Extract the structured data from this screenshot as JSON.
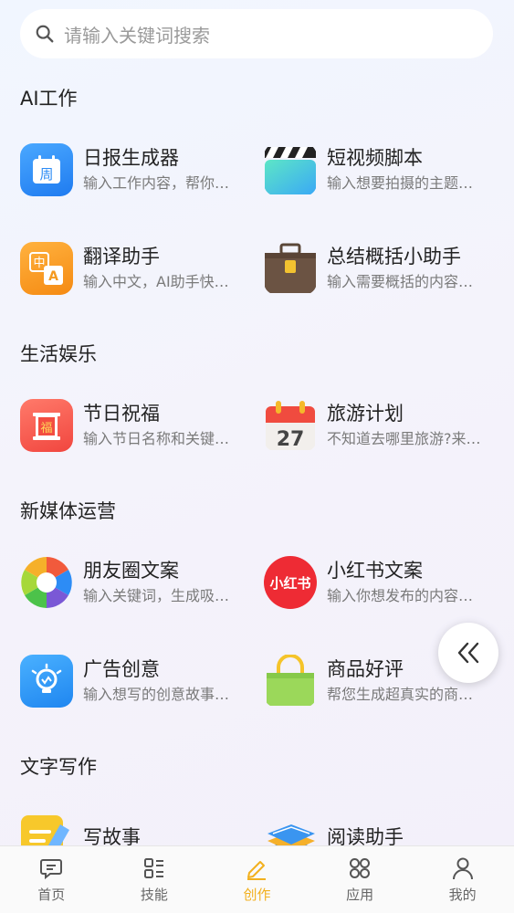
{
  "search": {
    "placeholder": "请输入关键词搜索"
  },
  "sections": [
    {
      "title": "AI工作",
      "items": [
        {
          "title": "日报生成器",
          "desc": "输入工作内容，帮你…",
          "icon": "calendar-week-icon"
        },
        {
          "title": "短视频脚本",
          "desc": "输入想要拍摄的主题…",
          "icon": "clapperboard-icon"
        },
        {
          "title": "翻译助手",
          "desc": "输入中文，AI助手快…",
          "icon": "translate-icon"
        },
        {
          "title": "总结概括小助手",
          "desc": "输入需要概括的内容…",
          "icon": "briefcase-icon"
        }
      ]
    },
    {
      "title": "生活娱乐",
      "items": [
        {
          "title": "节日祝福",
          "desc": "输入节日名称和关键…",
          "icon": "blessing-scroll-icon"
        },
        {
          "title": "旅游计划",
          "desc": "不知道去哪里旅游?来…",
          "icon": "calendar-27-icon"
        }
      ]
    },
    {
      "title": "新媒体运营",
      "items": [
        {
          "title": "朋友圈文案",
          "desc": "输入关键词，生成吸…",
          "icon": "aperture-icon"
        },
        {
          "title": "小红书文案",
          "desc": "输入你想发布的内容…",
          "icon": "xiaohongshu-logo-icon"
        },
        {
          "title": "广告创意",
          "desc": "输入想写的创意故事…",
          "icon": "lightbulb-idea-icon"
        },
        {
          "title": "商品好评",
          "desc": "帮您生成超真实的商…",
          "icon": "shopping-bag-icon"
        }
      ]
    },
    {
      "title": "文字写作",
      "items": [
        {
          "title": "写故事",
          "desc": "",
          "icon": "note-pencil-icon"
        },
        {
          "title": "阅读助手",
          "desc": "",
          "icon": "books-icon"
        }
      ]
    }
  ],
  "icon_text": {
    "week": "周",
    "zh": "中",
    "a": "A",
    "fu": "福",
    "day": "27",
    "xhs": "小红书"
  },
  "tabs": [
    {
      "label": "首页",
      "icon": "chat-bubble-icon",
      "active": false
    },
    {
      "label": "技能",
      "icon": "skills-list-icon",
      "active": false
    },
    {
      "label": "创作",
      "icon": "edit-pen-icon",
      "active": true
    },
    {
      "label": "应用",
      "icon": "apps-grid-icon",
      "active": false
    },
    {
      "label": "我的",
      "icon": "person-icon",
      "active": false
    }
  ],
  "colors": {
    "accent": "#f2b01e",
    "text": "#222222",
    "muted": "#7a7a7a"
  }
}
